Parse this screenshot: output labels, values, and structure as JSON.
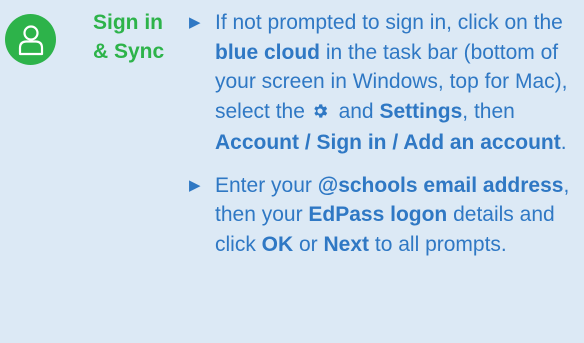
{
  "section": {
    "title_line1": "Sign in",
    "title_line2": "& Sync",
    "icon": "user-icon",
    "accent_color": "#2db34a",
    "text_color": "#2f78c4",
    "background_color": "#dce9f5"
  },
  "bullet1": {
    "t1": "If not prompted to sign in, click on the ",
    "b1": "blue cloud",
    "t2": " in the task bar (bottom of your screen in Windows, top for Mac), select the ",
    "gear_icon": "gear-icon",
    "t3": " and ",
    "b2": "Settings",
    "t4": ", then ",
    "b3": "Account / Sign in / Add an account",
    "t5": "."
  },
  "bullet2": {
    "t1": "Enter your ",
    "b1": "@schools email address",
    "t2": ", then your ",
    "b2": "EdPass logon",
    "t3": " details and click ",
    "b3": "OK",
    "t4": " or ",
    "b4": "Next",
    "t5": " to all prompts."
  }
}
